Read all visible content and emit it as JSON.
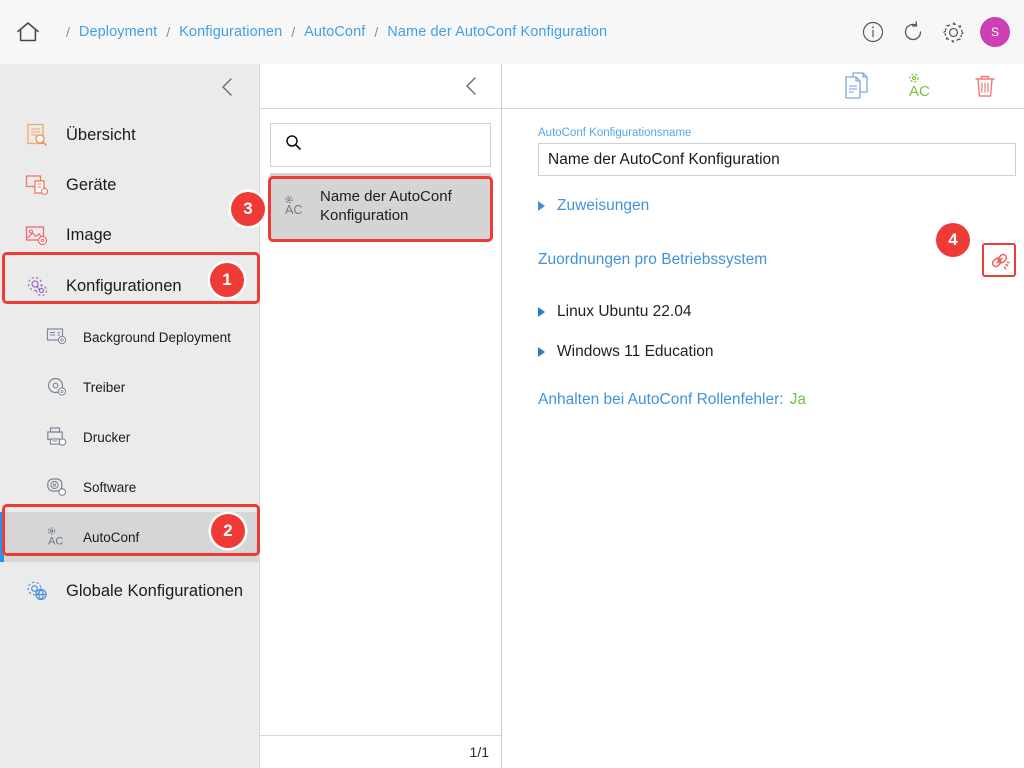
{
  "header": {
    "home_icon": "home-icon",
    "breadcrumb": [
      {
        "label": "Deployment"
      },
      {
        "label": "Konfigurationen"
      },
      {
        "label": "AutoConf"
      },
      {
        "label": "Name der AutoConf Konfiguration"
      }
    ],
    "separator": "/",
    "icons": [
      {
        "name": "info-icon"
      },
      {
        "name": "refresh-icon"
      },
      {
        "name": "settings-gear-icon"
      }
    ],
    "avatar_initial": "S",
    "avatar_color": "#cf3fb4"
  },
  "sidebar": {
    "collapse_icon": "chevron-left-icon",
    "items": [
      {
        "label": "Übersicht",
        "icon": "overview-document-icon",
        "color": "#f0a868"
      },
      {
        "label": "Geräte",
        "icon": "devices-icon",
        "color": "#ef7a5a"
      },
      {
        "label": "Image",
        "icon": "image-icon",
        "color": "#ee6b6b"
      },
      {
        "label": "Konfigurationen",
        "icon": "configurations-gear-icon",
        "color": "#9b6fc4"
      }
    ],
    "sub_items": [
      {
        "label": "Background Deployment",
        "icon": "background-deployment-icon"
      },
      {
        "label": "Treiber",
        "icon": "driver-disc-icon"
      },
      {
        "label": "Drucker",
        "icon": "printer-icon"
      },
      {
        "label": "Software",
        "icon": "software-disc-icon"
      },
      {
        "label": "AutoConf",
        "icon": "autoconf-icon"
      }
    ],
    "global": {
      "label": "Globale Konfigurationen",
      "icon": "global-config-globe-icon",
      "color": "#4a90d9"
    }
  },
  "list_panel": {
    "collapse_icon": "chevron-left-icon",
    "search": {
      "value": "",
      "placeholder": "",
      "icon": "search-icon"
    },
    "items": [
      {
        "label": "Name der AutoConf Konfiguration",
        "icon": "autoconf-icon"
      }
    ],
    "pager": "1/1"
  },
  "detail": {
    "toolbar": [
      {
        "name": "duplicate-document-icon",
        "color": "#7fa8d9"
      },
      {
        "name": "autoconf-icon",
        "color": "#7ac143"
      },
      {
        "name": "delete-trash-icon",
        "color": "#f07a7a"
      }
    ],
    "name_field": {
      "label": "AutoConf Konfigurationsname",
      "value": "Name der AutoConf Konfiguration"
    },
    "assignments_expander": "Zuweisungen",
    "os_section_title": "Zuordnungen pro Betriebssystem",
    "link_button_icon": "broken-link-icon",
    "os_entries": [
      {
        "label": "Linux Ubuntu 22.04"
      },
      {
        "label": "Windows 11 Education"
      }
    ],
    "status": {
      "key": "Anhalten bei AutoConf Rollenfehler:",
      "value": "Ja",
      "value_color": "#76c043"
    }
  },
  "annotations": {
    "badges": [
      {
        "number": "1",
        "target": "sidebar-item-konfigurationen"
      },
      {
        "number": "2",
        "target": "sidebar-item-autoconf"
      },
      {
        "number": "3",
        "target": "list-item-autoconf-konfiguration"
      },
      {
        "number": "4",
        "target": "link-assignments-button"
      }
    ],
    "highlight_color": "#ef3b36"
  }
}
